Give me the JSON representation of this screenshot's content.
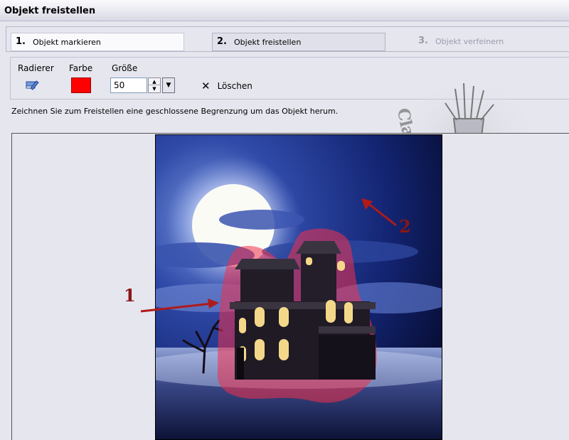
{
  "window": {
    "title": "Objekt freistellen"
  },
  "steps": [
    {
      "number": "1.",
      "label": "Objekt markieren"
    },
    {
      "number": "2.",
      "label": "Objekt freistellen"
    },
    {
      "number": "3.",
      "label": "Objekt verfeinern"
    }
  ],
  "tools": {
    "eraser_label": "Radierer",
    "color_label": "Farbe",
    "color_value": "#ff0000",
    "size_label": "Größe",
    "size_value": "50",
    "delete_label": "Löschen"
  },
  "instruction": "Zeichnen Sie zum Freistellen eine geschlossene Begrenzung um das Objekt herum.",
  "annotations": {
    "marker_1": "1",
    "marker_2": "2",
    "color": "#b01a1a"
  },
  "watermark": {
    "text": "Claudinia Claudinia"
  },
  "icons": {
    "eraser": "eraser-icon",
    "delete": "close-icon",
    "spin_up": "spin-up-icon",
    "spin_down": "spin-down-icon",
    "dropdown": "chevron-down-icon"
  }
}
